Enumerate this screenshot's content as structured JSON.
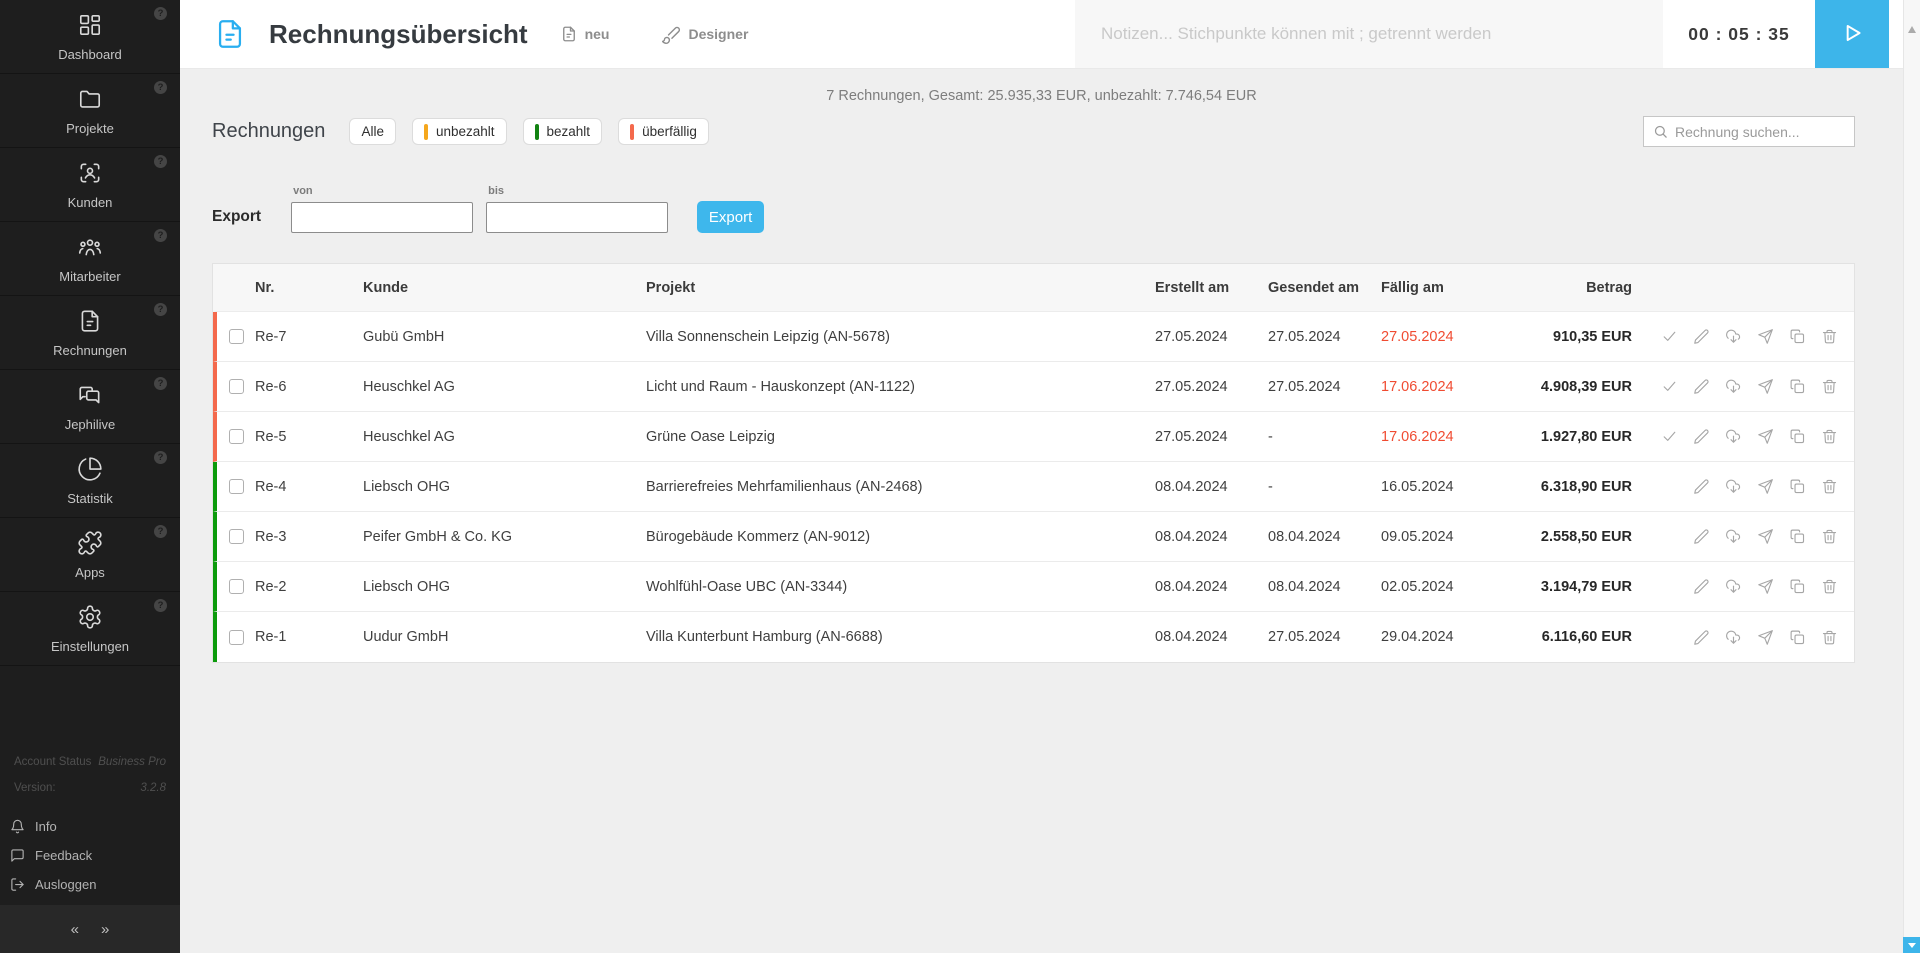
{
  "app": {
    "title": "Rechnungsübersicht",
    "actions": {
      "new_label": "neu",
      "designer_label": "Designer"
    },
    "notes_placeholder": "Notizen... Stichpunkte können mit ; getrennt werden",
    "timer": "00 : 05 : 35"
  },
  "sidebar": {
    "items": [
      {
        "label": "Dashboard",
        "icon": "dashboard"
      },
      {
        "label": "Projekte",
        "icon": "folder"
      },
      {
        "label": "Kunden",
        "icon": "customer-scan"
      },
      {
        "label": "Mitarbeiter",
        "icon": "team"
      },
      {
        "label": "Rechnungen",
        "icon": "invoice-file"
      },
      {
        "label": "Jephilive",
        "icon": "chat-bubbles"
      },
      {
        "label": "Statistik",
        "icon": "pie-chart"
      },
      {
        "label": "Apps",
        "icon": "puzzle"
      },
      {
        "label": "Einstellungen",
        "icon": "gear"
      }
    ],
    "account": {
      "status_label": "Account Status",
      "status_value": "Business Pro",
      "version_label": "Version:",
      "version_value": "3.2.8"
    },
    "links": [
      {
        "label": "Info",
        "icon": "bell"
      },
      {
        "label": "Feedback",
        "icon": "speech-bubble"
      },
      {
        "label": "Ausloggen",
        "icon": "logout"
      }
    ],
    "collapse": {
      "left": "«",
      "right": "»"
    }
  },
  "summary": "7 Rechnungen, Gesamt: 25.935,33 EUR, unbezahlt: 7.746,54 EUR",
  "list": {
    "heading": "Rechnungen",
    "chips": [
      {
        "label": "Alle",
        "color": null
      },
      {
        "label": "unbezahlt",
        "color": "#f5a71d"
      },
      {
        "label": "bezahlt",
        "color": "#128312"
      },
      {
        "label": "überfällig",
        "color": "#f4694c"
      }
    ],
    "search_placeholder": "Rechnung suchen..."
  },
  "export": {
    "label": "Export",
    "from_label": "von",
    "to_label": "bis",
    "from_value": "",
    "to_value": "",
    "button_label": "Export"
  },
  "table": {
    "columns": [
      "Nr.",
      "Kunde",
      "Projekt",
      "Erstellt am",
      "Gesendet am",
      "Fällig am",
      "Betrag"
    ],
    "rows": [
      {
        "nr": "Re-7",
        "kunde": "Gubü GmbH",
        "projekt": "Villa Sonnenschein Leipzig (AN-5678)",
        "erstellt": "27.05.2024",
        "gesendet": "27.05.2024",
        "faellig": "27.05.2024",
        "faellig_overdue": true,
        "betrag": "910,35 EUR",
        "status_color": "#f4694c",
        "can_mark_paid": true
      },
      {
        "nr": "Re-6",
        "kunde": "Heuschkel AG",
        "projekt": "Licht und Raum - Hauskonzept (AN-1122)",
        "erstellt": "27.05.2024",
        "gesendet": "27.05.2024",
        "faellig": "17.06.2024",
        "faellig_overdue": true,
        "betrag": "4.908,39 EUR",
        "status_color": "#f4694c",
        "can_mark_paid": true
      },
      {
        "nr": "Re-5",
        "kunde": "Heuschkel AG",
        "projekt": "Grüne Oase Leipzig",
        "erstellt": "27.05.2024",
        "gesendet": "-",
        "faellig": "17.06.2024",
        "faellig_overdue": true,
        "betrag": "1.927,80 EUR",
        "status_color": "#f4694c",
        "can_mark_paid": true
      },
      {
        "nr": "Re-4",
        "kunde": "Liebsch OHG",
        "projekt": "Barrierefreies Mehrfamilienhaus (AN-2468)",
        "erstellt": "08.04.2024",
        "gesendet": "-",
        "faellig": "16.05.2024",
        "faellig_overdue": false,
        "betrag": "6.318,90 EUR",
        "status_color": "#0c9b0c",
        "can_mark_paid": false
      },
      {
        "nr": "Re-3",
        "kunde": "Peifer GmbH & Co. KG",
        "projekt": "Bürogebäude Kommerz (AN-9012)",
        "erstellt": "08.04.2024",
        "gesendet": "08.04.2024",
        "faellig": "09.05.2024",
        "faellig_overdue": false,
        "betrag": "2.558,50 EUR",
        "status_color": "#0c9b0c",
        "can_mark_paid": false
      },
      {
        "nr": "Re-2",
        "kunde": "Liebsch OHG",
        "projekt": "Wohlfühl-Oase UBC (AN-3344)",
        "erstellt": "08.04.2024",
        "gesendet": "08.04.2024",
        "faellig": "02.05.2024",
        "faellig_overdue": false,
        "betrag": "3.194,79 EUR",
        "status_color": "#0c9b0c",
        "can_mark_paid": false
      },
      {
        "nr": "Re-1",
        "kunde": "Uudur GmbH",
        "projekt": "Villa Kunterbunt Hamburg (AN-6688)",
        "erstellt": "08.04.2024",
        "gesendet": "27.05.2024",
        "faellig": "29.04.2024",
        "faellig_overdue": false,
        "betrag": "6.116,60 EUR",
        "status_color": "#0c9b0c",
        "can_mark_paid": false
      }
    ],
    "row_actions": [
      "mark-paid",
      "edit",
      "download",
      "send",
      "duplicate",
      "delete"
    ]
  },
  "colors": {
    "accent_blue": "#3db5ea",
    "overdue_red": "#f4694c",
    "paid_green": "#0c9b0c",
    "unpaid_amber": "#f5a71d",
    "due_text_red": "#f04b31"
  }
}
